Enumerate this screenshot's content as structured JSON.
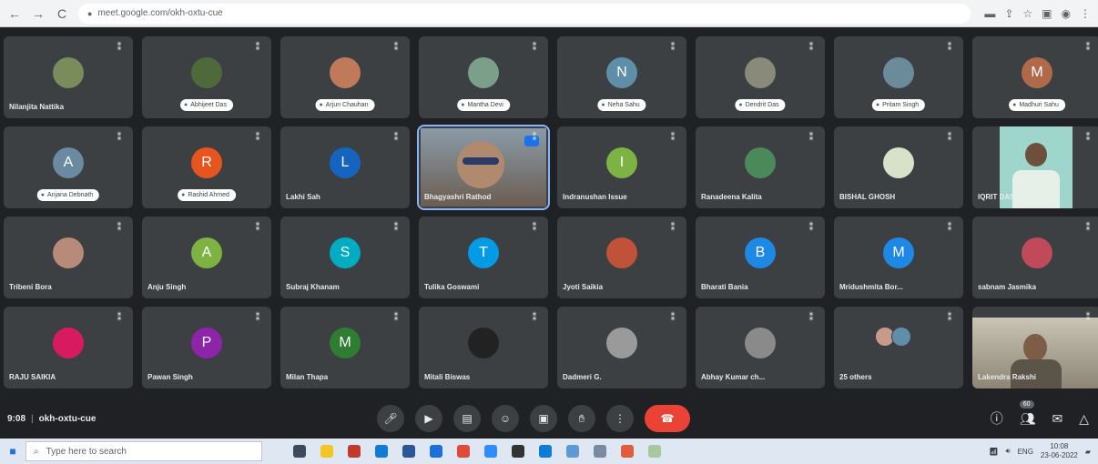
{
  "browser": {
    "url": "meet.google.com/okh-oxtu-cue",
    "nav_back": "←",
    "nav_forward": "→",
    "nav_reload": "C"
  },
  "participants": [
    {
      "name": "Nilanjita Nattika",
      "type": "photo",
      "color": "#7a8c5a",
      "style": "plain"
    },
    {
      "name": "Abhijeet Das",
      "type": "photo",
      "color": "#4e6a3a",
      "style": "pill"
    },
    {
      "name": "Arjun Chauhan",
      "type": "photo",
      "color": "#c07a5a",
      "style": "pill"
    },
    {
      "name": "Mantha Devi",
      "type": "photo",
      "color": "#7aa08a",
      "style": "pill"
    },
    {
      "name": "Neha Sahu",
      "type": "initial",
      "initial": "N",
      "color": "#5f8fa8",
      "style": "pill"
    },
    {
      "name": "Dendrit Das",
      "type": "photo",
      "color": "#8a8a7a",
      "style": "pill"
    },
    {
      "name": "Pritam Singh",
      "type": "photo",
      "color": "#6b8a9a",
      "style": "pill"
    },
    {
      "name": "Madhuri Sahu",
      "type": "initial",
      "initial": "M",
      "color": "#b06a4a",
      "style": "pill"
    },
    {
      "name": "Anjana Debnath",
      "type": "initial",
      "initial": "A",
      "color": "#6a8aa0",
      "style": "pill"
    },
    {
      "name": "Rashid Ahmed",
      "type": "initial",
      "initial": "R",
      "color": "#e8541e",
      "style": "pill"
    },
    {
      "name": "Lakhi Sah",
      "type": "initial",
      "initial": "L",
      "color": "#1565c0",
      "style": "plain"
    },
    {
      "name": "Bhagyashri Rathod",
      "type": "video-blue",
      "color": "#8a9ba8",
      "style": "plain"
    },
    {
      "name": "Indranushan Issue",
      "type": "initial",
      "initial": "I",
      "color": "#7cb342",
      "style": "plain"
    },
    {
      "name": "Ranadeena Kalita",
      "type": "photo",
      "color": "#4a8a5a",
      "style": "plain"
    },
    {
      "name": "BISHAL GHOSH",
      "type": "photo",
      "color": "#d8e2c8",
      "style": "plain"
    },
    {
      "name": "IQRIT DAS",
      "type": "video-cyan",
      "color": "#9fd6cc",
      "style": "plain"
    },
    {
      "name": "Tribeni Bora",
      "type": "photo",
      "color": "#b88a7a",
      "style": "plain"
    },
    {
      "name": "Anju Singh",
      "type": "initial",
      "initial": "A",
      "color": "#7cb342",
      "style": "plain"
    },
    {
      "name": "Subraj Khanam",
      "type": "initial",
      "initial": "S",
      "color": "#00acc1",
      "style": "plain"
    },
    {
      "name": "Tulika Goswami",
      "type": "initial",
      "initial": "T",
      "color": "#039be5",
      "style": "plain"
    },
    {
      "name": "Jyoti Saikia",
      "type": "photo",
      "color": "#c0523a",
      "style": "plain"
    },
    {
      "name": "Bharati Bania",
      "type": "initial",
      "initial": "B",
      "color": "#1e88e5",
      "style": "plain"
    },
    {
      "name": "Mridushmita Bor...",
      "type": "initial",
      "initial": "M",
      "color": "#1e88e5",
      "style": "plain"
    },
    {
      "name": "sabnam Jasmika",
      "type": "photo",
      "color": "#c04a5a",
      "style": "plain"
    },
    {
      "name": "RAJU SAIKIA",
      "type": "photo",
      "color": "#d81b60",
      "style": "plain"
    },
    {
      "name": "Pawan Singh",
      "type": "initial",
      "initial": "P",
      "color": "#8e24aa",
      "style": "plain"
    },
    {
      "name": "Milan Thapa",
      "type": "initial",
      "initial": "M",
      "color": "#2e7d32",
      "style": "plain"
    },
    {
      "name": "Mitali Biswas",
      "type": "photo",
      "color": "#222222",
      "style": "plain"
    },
    {
      "name": "Dadmeri G.",
      "type": "photo",
      "color": "#9a9a9a",
      "style": "plain"
    },
    {
      "name": "Abhay Kumar ch...",
      "type": "photo",
      "color": "#8a8a8a",
      "style": "plain"
    },
    {
      "name": "25 others",
      "type": "others",
      "color": "#5f8fa8",
      "style": "plain"
    },
    {
      "name": "Lakendra Rakshi",
      "type": "video-room",
      "color": "#c9c4b4",
      "style": "plain"
    }
  ],
  "bottom_bar": {
    "time": "9:08",
    "separator": "|",
    "meeting_code": "okh-oxtu-cue",
    "participant_count": "60"
  },
  "controls": [
    "mic-icon",
    "camera-icon",
    "captions-icon",
    "emoji-icon",
    "present-icon",
    "raise-hand-icon",
    "more-icon",
    "end-call-icon"
  ],
  "taskbar": {
    "search_placeholder": "Type here to search",
    "language": "ENG",
    "time": "10:08",
    "date": "23-06-2022"
  }
}
